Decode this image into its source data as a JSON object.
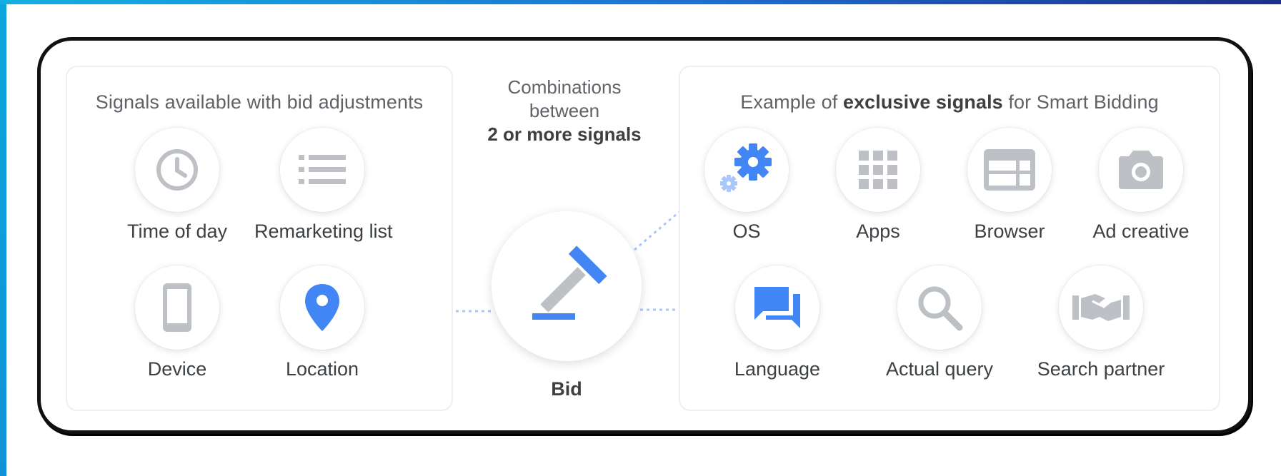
{
  "left_panel": {
    "title": "Signals available with bid adjustments",
    "signals": [
      {
        "label": "Time of day",
        "icon": "clock-icon"
      },
      {
        "label": "Remarketing list",
        "icon": "list-icon"
      },
      {
        "label": "Device",
        "icon": "smartphone-icon"
      },
      {
        "label": "Location",
        "icon": "location-pin-icon"
      }
    ]
  },
  "center": {
    "line1": "Combinations",
    "line2": "between",
    "line3": "2 or more signals",
    "bid_label": "Bid",
    "icon": "gavel-icon"
  },
  "right_panel": {
    "title_pre": "Example of ",
    "title_bold": "exclusive signals",
    "title_post": " for Smart Bidding",
    "signals": [
      {
        "label": "OS",
        "icon": "gear-icon"
      },
      {
        "label": "Apps",
        "icon": "apps-grid-icon"
      },
      {
        "label": "Browser",
        "icon": "browser-window-icon"
      },
      {
        "label": "Ad creative",
        "icon": "camera-icon"
      },
      {
        "label": "Language",
        "icon": "chat-bubbles-icon"
      },
      {
        "label": "Actual query",
        "icon": "search-icon"
      },
      {
        "label": "Search partner",
        "icon": "handshake-icon"
      }
    ]
  },
  "colors": {
    "accent_blue": "#4285f4",
    "icon_gray": "#bdc1c6",
    "text_gray": "#5f6368",
    "connector": "#a8c7fa"
  }
}
